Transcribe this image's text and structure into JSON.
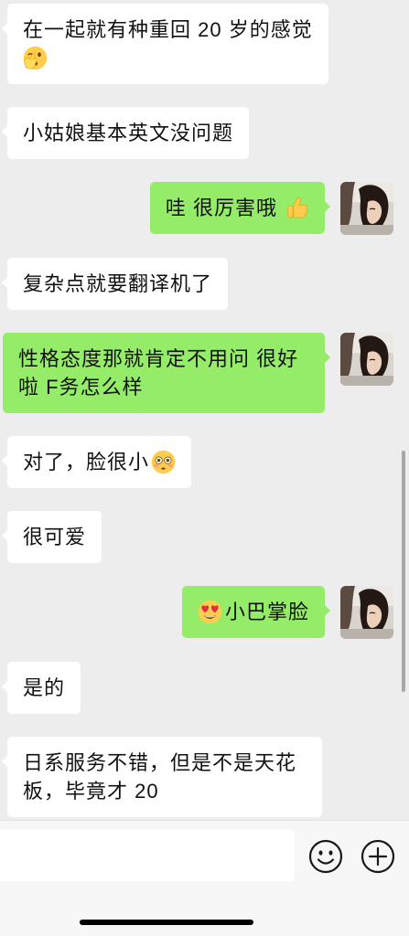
{
  "colors": {
    "chat_background": "#ededed",
    "incoming_bubble": "#ffffff",
    "outgoing_bubble": "#95ec69",
    "input_bar_background": "#f7f7f7",
    "text": "#111111"
  },
  "chat": {
    "messages": [
      {
        "outgoing": false,
        "text": "在一起就有种重回 20 岁的感觉",
        "emoji_after": "face-with-peeking-eye-icon"
      },
      {
        "outgoing": false,
        "text": "小姑娘基本英文没问题"
      },
      {
        "outgoing": true,
        "text": "哇 很厉害哦",
        "emoji_after": "thumbs-up-icon"
      },
      {
        "outgoing": false,
        "text": "复杂点就要翻译机了"
      },
      {
        "outgoing": true,
        "text": "性格态度那就肯定不用问 很好啦 F务怎么样"
      },
      {
        "outgoing": false,
        "text": "对了，脸很小",
        "emoji_after": "flushed-face-icon"
      },
      {
        "outgoing": false,
        "text": "很可爱"
      },
      {
        "outgoing": true,
        "text": "小巴掌脸",
        "emoji_before": "smiling-face-with-heart-eyes-icon"
      },
      {
        "outgoing": false,
        "text": "是的"
      },
      {
        "outgoing": false,
        "text": "日系服务不错，但是不是天花板，毕竟才 20"
      }
    ]
  },
  "input_bar": {
    "message_value": "",
    "emoji_button_icon": "smiley-icon",
    "more_button_icon": "plus-circle-icon"
  }
}
